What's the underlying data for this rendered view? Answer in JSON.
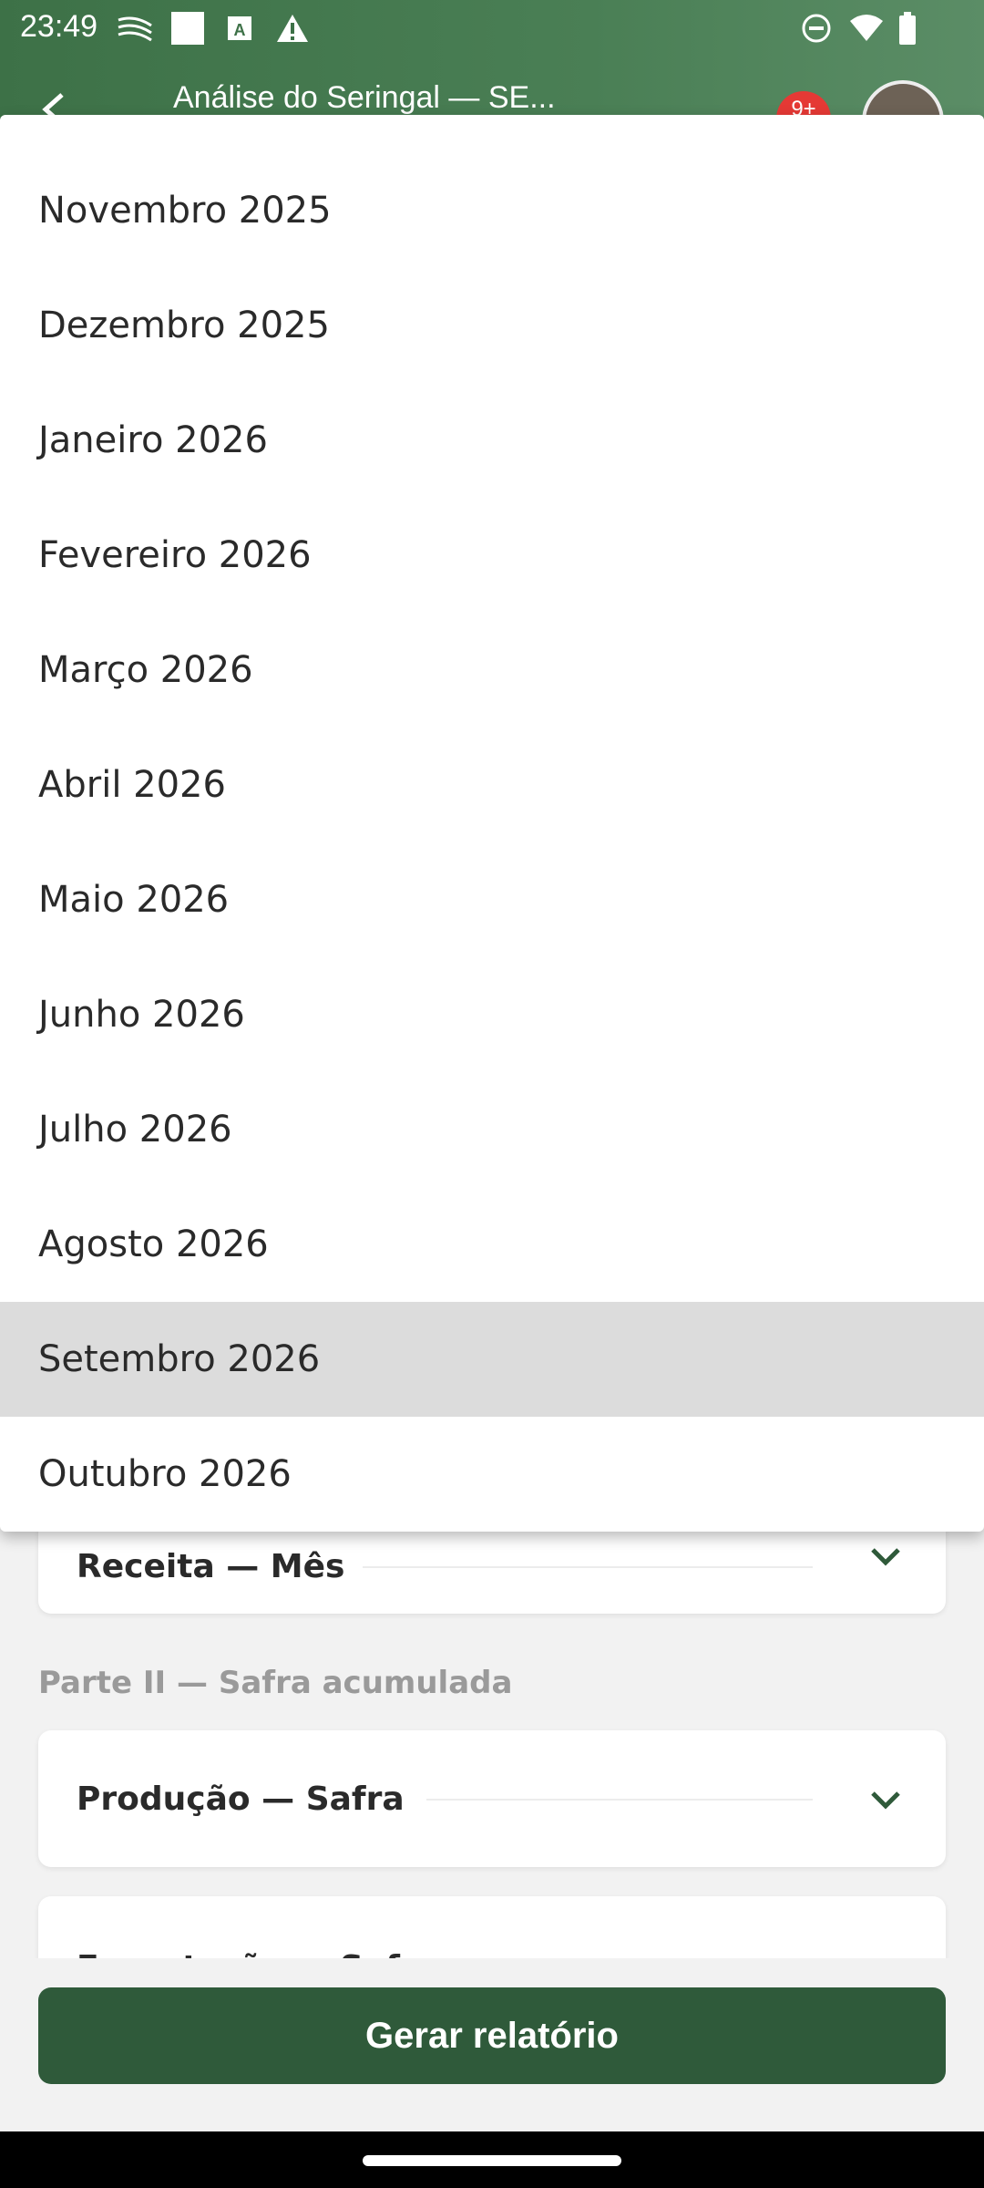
{
  "status_bar": {
    "time": "23:49",
    "icons": [
      "signal-stripes-icon",
      "square-notification-icon",
      "text-a-icon",
      "warning-icon",
      "do-not-disturb-icon",
      "wifi-icon",
      "battery-icon"
    ]
  },
  "app_bar": {
    "title": "Análise do Seringal — SE...",
    "badge_text": "9+"
  },
  "dropdown": {
    "items": [
      "Novembro 2025",
      "Dezembro 2025",
      "Janeiro 2026",
      "Fevereiro 2026",
      "Março 2026",
      "Abril 2026",
      "Maio 2026",
      "Junho 2026",
      "Julho 2026",
      "Agosto 2026",
      "Setembro 2026",
      "Outubro 2026"
    ],
    "selected": "Setembro 2026"
  },
  "content": {
    "card_receita_title": "Receita — Mês",
    "section_part2": "Parte II — Safra acumulada",
    "card_producao_title": "Produção — Safra",
    "card_partial_title": "Exportação — Safra"
  },
  "footer": {
    "generate_button": "Gerar relatório"
  },
  "colors": {
    "header_green": "#3d7147",
    "button_green": "#2f5a3a",
    "selected_item_bg": "#dcdcdc"
  }
}
